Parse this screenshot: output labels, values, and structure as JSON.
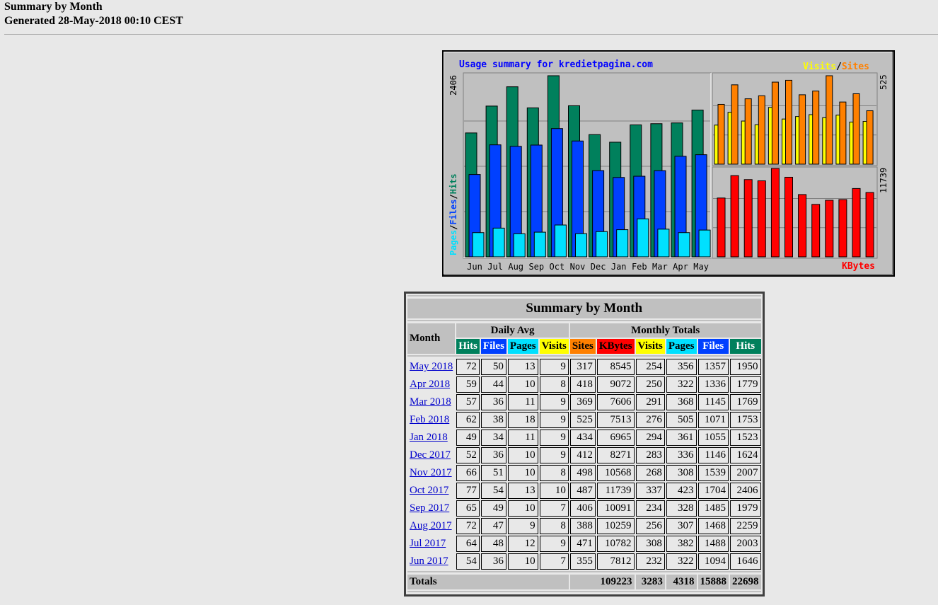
{
  "header": {
    "title": "Summary by Month",
    "generated": "Generated 28-May-2018 00:10 CEST"
  },
  "graph": {
    "title": "Usage summary for kredietpagina.com",
    "legend_right_visits": "Visits",
    "legend_slash": "/",
    "legend_right_sites": "Sites",
    "legend_kbytes": "KBytes",
    "legend_left_pages": "Pages",
    "legend_left_files": "Files",
    "legend_left_hits": "Hits",
    "max_left": "2406",
    "max_right_top": "525",
    "max_right_bottom": "11739",
    "months": [
      "Jun",
      "Jul",
      "Aug",
      "Sep",
      "Oct",
      "Nov",
      "Dec",
      "Jan",
      "Feb",
      "Mar",
      "Apr",
      "May"
    ],
    "colors": {
      "hits": "#00805c",
      "files": "#0040ff",
      "pages": "#00e0ff",
      "visits": "#ffff00",
      "sites": "#ff8000",
      "kbytes": "#ff0000",
      "title": "#0000ff"
    }
  },
  "chart_data": {
    "type": "bar",
    "categories": [
      "Jun",
      "Jul",
      "Aug",
      "Sep",
      "Oct",
      "Nov",
      "Dec",
      "Jan",
      "Feb",
      "Mar",
      "Apr",
      "May"
    ],
    "series": [
      {
        "name": "Hits",
        "values": [
          1646,
          2003,
          2259,
          1979,
          2406,
          2007,
          1624,
          1523,
          1753,
          1769,
          1779,
          1950
        ]
      },
      {
        "name": "Files",
        "values": [
          1094,
          1488,
          1468,
          1485,
          1704,
          1539,
          1146,
          1055,
          1071,
          1145,
          1336,
          1357
        ]
      },
      {
        "name": "Pages",
        "values": [
          322,
          382,
          307,
          328,
          423,
          308,
          336,
          361,
          505,
          368,
          322,
          356
        ]
      },
      {
        "name": "Visits",
        "values": [
          232,
          308,
          256,
          234,
          337,
          268,
          283,
          294,
          276,
          291,
          250,
          254
        ]
      },
      {
        "name": "Sites",
        "values": [
          355,
          471,
          388,
          406,
          487,
          498,
          412,
          434,
          525,
          369,
          418,
          317
        ]
      },
      {
        "name": "KBytes",
        "values": [
          7812,
          10782,
          10259,
          10091,
          11739,
          10568,
          8271,
          6965,
          7513,
          7606,
          9072,
          8545
        ]
      }
    ],
    "title": "Usage summary for kredietpagina.com"
  },
  "table": {
    "title": "Summary by Month",
    "month_label": "Month",
    "daily_avg_label": "Daily Avg",
    "monthly_totals_label": "Monthly Totals",
    "daily_cols": [
      "Hits",
      "Files",
      "Pages",
      "Visits"
    ],
    "monthly_cols": [
      "Sites",
      "KBytes",
      "Visits",
      "Pages",
      "Files",
      "Hits"
    ],
    "rows": [
      {
        "month": "May 2018",
        "hits": "72",
        "files": "50",
        "pages": "13",
        "visits": "9",
        "sites": "317",
        "kbytes": "8545",
        "t_visits": "254",
        "t_pages": "356",
        "t_files": "1357",
        "t_hits": "1950"
      },
      {
        "month": "Apr 2018",
        "hits": "59",
        "files": "44",
        "pages": "10",
        "visits": "8",
        "sites": "418",
        "kbytes": "9072",
        "t_visits": "250",
        "t_pages": "322",
        "t_files": "1336",
        "t_hits": "1779"
      },
      {
        "month": "Mar 2018",
        "hits": "57",
        "files": "36",
        "pages": "11",
        "visits": "9",
        "sites": "369",
        "kbytes": "7606",
        "t_visits": "291",
        "t_pages": "368",
        "t_files": "1145",
        "t_hits": "1769"
      },
      {
        "month": "Feb 2018",
        "hits": "62",
        "files": "38",
        "pages": "18",
        "visits": "9",
        "sites": "525",
        "kbytes": "7513",
        "t_visits": "276",
        "t_pages": "505",
        "t_files": "1071",
        "t_hits": "1753"
      },
      {
        "month": "Jan 2018",
        "hits": "49",
        "files": "34",
        "pages": "11",
        "visits": "9",
        "sites": "434",
        "kbytes": "6965",
        "t_visits": "294",
        "t_pages": "361",
        "t_files": "1055",
        "t_hits": "1523"
      },
      {
        "month": "Dec 2017",
        "hits": "52",
        "files": "36",
        "pages": "10",
        "visits": "9",
        "sites": "412",
        "kbytes": "8271",
        "t_visits": "283",
        "t_pages": "336",
        "t_files": "1146",
        "t_hits": "1624"
      },
      {
        "month": "Nov 2017",
        "hits": "66",
        "files": "51",
        "pages": "10",
        "visits": "8",
        "sites": "498",
        "kbytes": "10568",
        "t_visits": "268",
        "t_pages": "308",
        "t_files": "1539",
        "t_hits": "2007"
      },
      {
        "month": "Oct 2017",
        "hits": "77",
        "files": "54",
        "pages": "13",
        "visits": "10",
        "sites": "487",
        "kbytes": "11739",
        "t_visits": "337",
        "t_pages": "423",
        "t_files": "1704",
        "t_hits": "2406"
      },
      {
        "month": "Sep 2017",
        "hits": "65",
        "files": "49",
        "pages": "10",
        "visits": "7",
        "sites": "406",
        "kbytes": "10091",
        "t_visits": "234",
        "t_pages": "328",
        "t_files": "1485",
        "t_hits": "1979"
      },
      {
        "month": "Aug 2017",
        "hits": "72",
        "files": "47",
        "pages": "9",
        "visits": "8",
        "sites": "388",
        "kbytes": "10259",
        "t_visits": "256",
        "t_pages": "307",
        "t_files": "1468",
        "t_hits": "2259"
      },
      {
        "month": "Jul 2017",
        "hits": "64",
        "files": "48",
        "pages": "12",
        "visits": "9",
        "sites": "471",
        "kbytes": "10782",
        "t_visits": "308",
        "t_pages": "382",
        "t_files": "1488",
        "t_hits": "2003"
      },
      {
        "month": "Jun 2017",
        "hits": "54",
        "files": "36",
        "pages": "10",
        "visits": "7",
        "sites": "355",
        "kbytes": "7812",
        "t_visits": "232",
        "t_pages": "322",
        "t_files": "1094",
        "t_hits": "1646"
      }
    ],
    "totals": {
      "label": "Totals",
      "kbytes": "109223",
      "visits": "3283",
      "pages": "4318",
      "files": "15888",
      "hits": "22698"
    }
  }
}
